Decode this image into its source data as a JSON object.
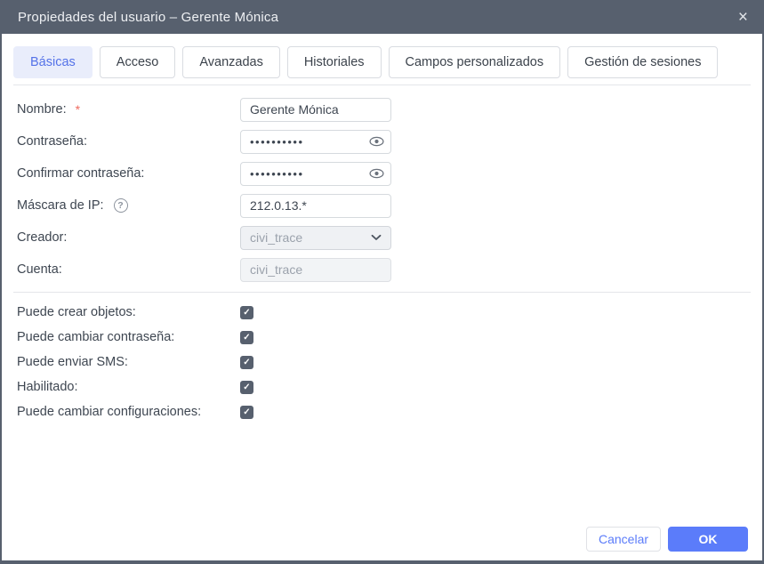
{
  "dialog": {
    "title": "Propiedades del usuario – Gerente Mónica"
  },
  "icons": {
    "close": "×",
    "help": "?",
    "check": "✓"
  },
  "colors": {
    "titlebar": "#57606e",
    "accent_blue": "#5b7cfa",
    "active_tab_bg": "#e9edfb",
    "active_tab_text": "#5472e8",
    "border_gray": "#d9dce1",
    "label_text": "#3e4651",
    "disabled_bg": "#eff1f4",
    "disabled_text": "#9ba2ac",
    "required_red": "#ef6a5f"
  },
  "tabs": [
    {
      "label": "Básicas",
      "active": true
    },
    {
      "label": "Acceso",
      "active": false
    },
    {
      "label": "Avanzadas",
      "active": false
    },
    {
      "label": "Historiales",
      "active": false
    },
    {
      "label": "Campos personalizados",
      "active": false
    },
    {
      "label": "Gestión de sesiones",
      "active": false
    }
  ],
  "form": {
    "nombre": {
      "label": "Nombre:",
      "required_mark": "*",
      "value": "Gerente Mónica"
    },
    "contrasena": {
      "label": "Contraseña:",
      "value": "••••••••••"
    },
    "confirmar": {
      "label": "Confirmar contraseña:",
      "value": "••••••••••"
    },
    "mascara": {
      "label": "Máscara de IP:",
      "value": "212.0.13.*"
    },
    "creador": {
      "label": "Creador:",
      "value": "civi_trace"
    },
    "cuenta": {
      "label": "Cuenta:",
      "value": "civi_trace"
    }
  },
  "checkboxes": [
    {
      "label": "Puede crear objetos:",
      "checked": true
    },
    {
      "label": "Puede cambiar contraseña:",
      "checked": true
    },
    {
      "label": "Puede enviar SMS:",
      "checked": true
    },
    {
      "label": "Habilitado:",
      "checked": true
    },
    {
      "label": "Puede cambiar configuraciones:",
      "checked": true
    }
  ],
  "footer": {
    "cancel_label": "Cancelar",
    "ok_label": "OK"
  }
}
